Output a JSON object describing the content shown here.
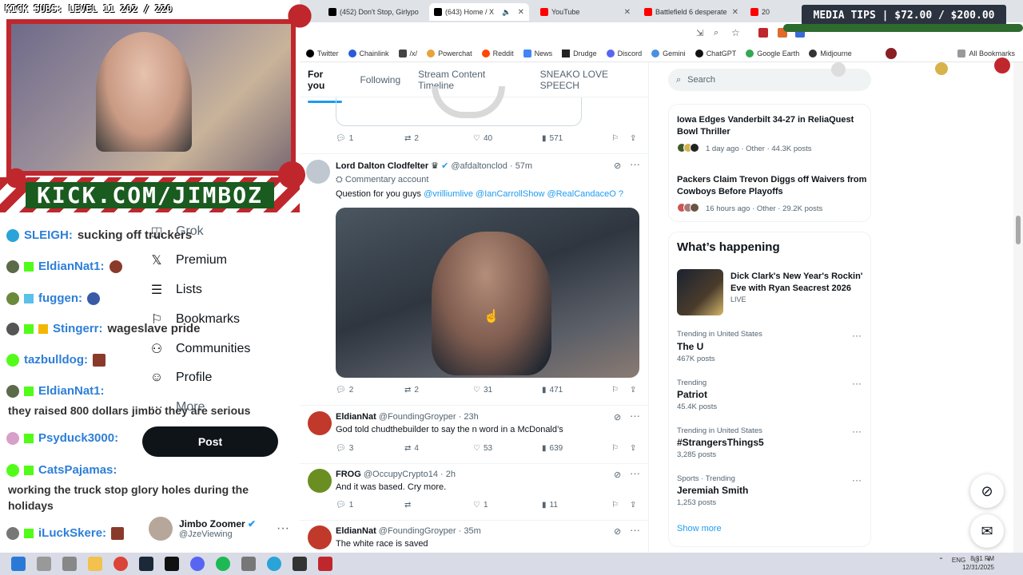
{
  "stream": {
    "subs_text": "KICK SUBS: LEVEL 11 202 / 220",
    "banner_text": "KICK.COM/JIMBOZ",
    "media_tips": "MEDIA TIPS | $72.00 / $200.00",
    "chat": [
      {
        "name": "SLEIGH:",
        "msg": "sucking off truckers",
        "color": "#2d7fd8"
      },
      {
        "name": "EldianNat1:",
        "msg": "",
        "color": "#2d7fd8"
      },
      {
        "name": "fuggen:",
        "msg": "",
        "color": "#2d7fd8"
      },
      {
        "name": "Stingerr:",
        "msg": "wageslave pride",
        "color": "#2d7fd8"
      },
      {
        "name": "tazbulldog:",
        "msg": "",
        "color": "#2d7fd8"
      },
      {
        "name": "EldianNat1:",
        "msg": "they raised 800 dollars jimbo they are serious",
        "color": "#2d7fd8"
      },
      {
        "name": "Psyduck3000:",
        "msg": "",
        "color": "#2d7fd8"
      },
      {
        "name": "CatsPajamas:",
        "msg": "working the truck stop glory holes during the holidays",
        "color": "#2d7fd8"
      },
      {
        "name": "iLuckSkere:",
        "msg": "",
        "color": "#2d7fd8"
      }
    ]
  },
  "browser": {
    "tabs": [
      {
        "label": "(452) Don't Stop, Girlypo",
        "icon": "x-icon"
      },
      {
        "label": "(643) Home / X",
        "icon": "x-icon"
      },
      {
        "label": "YouTube",
        "icon": "youtube-icon"
      },
      {
        "label": "Battlefield 6 desperate",
        "icon": "youtube-icon"
      },
      {
        "label": "20",
        "icon": "youtube-icon"
      }
    ],
    "bookmarks": [
      "Twitter",
      "Chainlink",
      "/x/",
      "Powerchat",
      "Reddit",
      "News",
      "Drudge",
      "Discord",
      "Gemini",
      "ChatGPT",
      "Google Earth",
      "Midjourne",
      "All Bookmarks"
    ]
  },
  "nav": {
    "grok": "Grok",
    "premium": "Premium",
    "lists": "Lists",
    "bookmarks": "Bookmarks",
    "communities": "Communities",
    "profile": "Profile",
    "more": "More",
    "post": "Post",
    "account_name": "Jimbo Zoomer",
    "account_handle": "@JzeViewing"
  },
  "feed": {
    "tabs": [
      "For you",
      "Following",
      "Stream Content Timeline",
      "SNEAKO LOVE SPEECH"
    ],
    "top_actions": {
      "replies": "1",
      "reposts": "2",
      "likes": "40",
      "views": "571"
    },
    "tweets": [
      {
        "name": "Lord Dalton Clodfelter",
        "handle": "@afdaltonclod",
        "time": "57m",
        "label": "Commentary account",
        "text": "Question for you guys",
        "mentions": "@vrilliumlive @IanCarrollShow @RealCandaceO ?",
        "replies": "2",
        "reposts": "2",
        "likes": "31",
        "views": "471"
      },
      {
        "name": "EldianNat",
        "handle": "@FoundingGroyper",
        "time": "23h",
        "text": "God told chudthebuilder to say the n word in a McDonald’s",
        "replies": "3",
        "reposts": "4",
        "likes": "53",
        "views": "639"
      },
      {
        "name": "FROG",
        "handle": "@OccupyCrypto14",
        "time": "2h",
        "text": "And it was based. Cry more.",
        "replies": "1",
        "reposts": "",
        "likes": "1",
        "views": "11"
      },
      {
        "name": "EldianNat",
        "handle": "@FoundingGroyper",
        "time": "35m",
        "text": "The white race is saved"
      }
    ]
  },
  "sidebar": {
    "search_placeholder": "Search",
    "news": [
      {
        "title": "Iowa Edges Vanderbilt 34-27 in ReliaQuest Bowl Thriller",
        "meta": "1 day ago · Other · 44.3K posts"
      },
      {
        "title": "Packers Claim Trevon Diggs off Waivers from Cowboys Before Playoffs",
        "meta": "16 hours ago · Other · 29.2K posts"
      }
    ],
    "whats_happening": "What’s happening",
    "event": {
      "title": "Dick Clark's New Year's Rockin' Eve with Ryan Seacrest 2026",
      "status": "LIVE"
    },
    "trends": [
      {
        "label": "Trending in United States",
        "name": "The U",
        "count": "467K posts"
      },
      {
        "label": "Trending",
        "name": "Patriot",
        "count": "45.4K posts"
      },
      {
        "label": "Trending in United States",
        "name": "#StrangersThings5",
        "count": "3,285 posts"
      },
      {
        "label": "Sports · Trending",
        "name": "Jeremiah Smith",
        "count": "1,253 posts"
      }
    ],
    "show_more": "Show more"
  },
  "taskbar": {
    "lang": "ENG",
    "time": "8:31 PM",
    "date": "12/31/2025"
  },
  "colors": {
    "accent": "#1d9bf0",
    "kick_green": "#53fc18",
    "christmas_red": "#c0272d"
  }
}
